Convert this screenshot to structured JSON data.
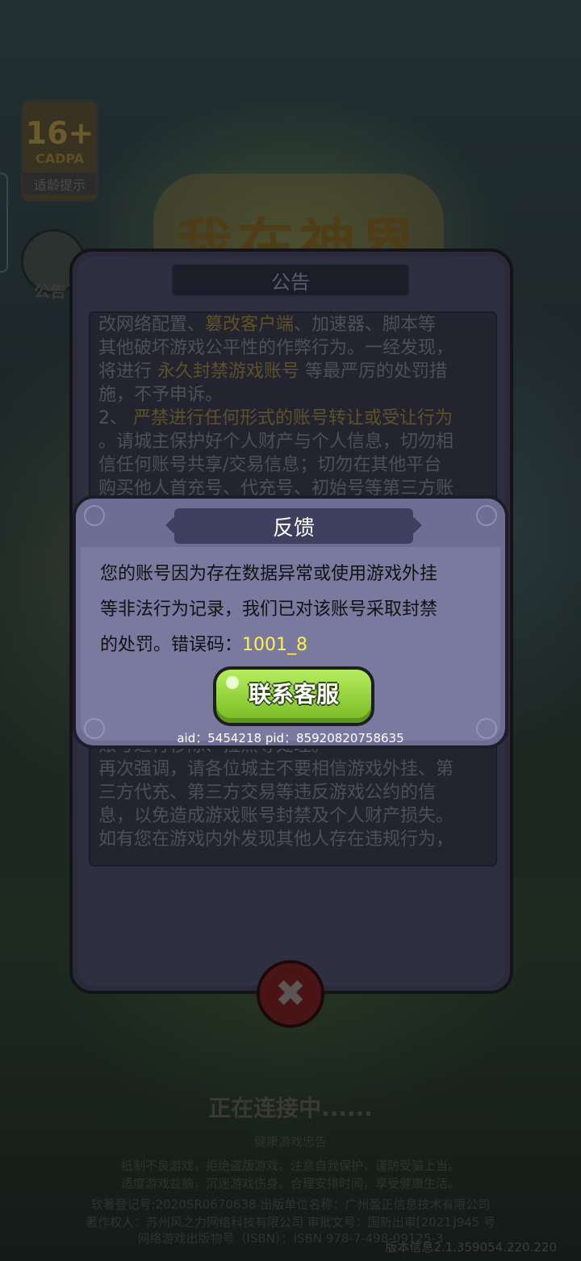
{
  "background": {
    "age_rating": {
      "age": "16+",
      "org": "CADPA",
      "label": "适龄提示"
    },
    "notice_shortcut_label": "公告",
    "game_logo": "我在神界",
    "connecting_text": "正在连接中......",
    "footer_lines": [
      "健康游戏忠告",
      "抵制不良游戏，拒绝盗版游戏。注意自我保护，谨防受骗上当。",
      "适度游戏益脑，沉迷游戏伤身。合理安排时间，享受健康生活。",
      "软著登记号:2020SR0670638 出版单位名称：广州盈正信息技术有限公司",
      "著作权人：苏州风之力网络科技有限公司 审批文号：国新出审[2021]945 号",
      "网络游戏出版物号（ISBN）：ISBN 978-7-498-09125-3"
    ],
    "version": "版本信息2.1.359054.220.220"
  },
  "notice_panel": {
    "title": "公告",
    "lines": [
      [
        {
          "t": "改网络配置、"
        },
        {
          "t": "篡改客户端",
          "hl": true
        },
        {
          "t": "、加速器、脚本等"
        }
      ],
      [
        {
          "t": "其他破坏游戏公平性的作弊行为。一经发现，"
        }
      ],
      [
        {
          "t": "将进行 "
        },
        {
          "t": "永久封禁游戏账号",
          "hl": true
        },
        {
          "t": " 等最严厉的处罚措"
        }
      ],
      [
        {
          "t": "施，不予申诉。"
        }
      ],
      [
        {
          "t": "2、 "
        },
        {
          "t": "严禁进行任何形式的账号转让或受让行为",
          "hl": true
        }
      ],
      [
        {
          "t": "。请城主保护好个人财产与个人信息，切勿相"
        }
      ],
      [
        {
          "t": "信任何账号共享/交易信息；切勿在其他平台"
        }
      ],
      [
        {
          "t": "购买他人首充号、代充号、初始号等第三方账"
        }
      ],
      [
        {
          "t": ""
        }
      ],
      [
        {
          "t": ""
        }
      ],
      [
        {
          "t": ""
        }
      ],
      [
        {
          "t": ""
        }
      ],
      [
        {
          "t": ""
        }
      ],
      [
        {
          "t": ""
        }
      ],
      [
        {
          "t": ""
        }
      ],
      [
        {
          "t": ""
        }
      ],
      [
        {
          "t": ""
        }
      ],
      [
        {
          "t": ""
        }
      ],
      [
        {
          "t": "账号进行移除、拉黑等处理。"
        }
      ],
      [
        {
          "t": "再次强调，请各位城主不要相信游戏外挂、第"
        }
      ],
      [
        {
          "t": "三方代充、第三方交易等违反游戏公约的信"
        }
      ],
      [
        {
          "t": "息，以免造成游戏账号封禁及个人财产损失。"
        }
      ],
      [
        {
          "t": "如有您在游戏内外发现其他人存在违规行为，"
        }
      ]
    ],
    "close_icon": "close-x-icon"
  },
  "feedback_dialog": {
    "title": "反馈",
    "message_line1": "您的账号因为存在数据异常或使用游戏外挂",
    "message_line2": "等非法行为记录，我们已对该账号采取封禁",
    "message_line3_prefix": "的处罚。错误码：",
    "error_code": "1001_8",
    "contact_button": "联系客服",
    "ids": "aid：5454218 pid：85920820758635"
  }
}
